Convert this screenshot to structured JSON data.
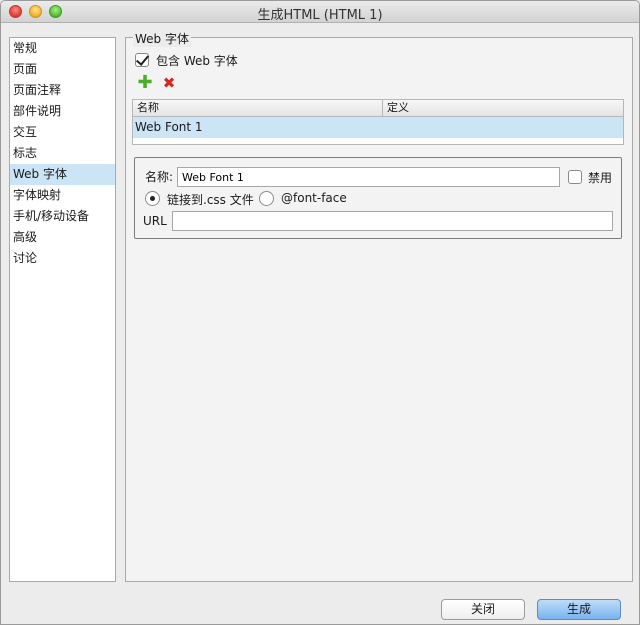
{
  "window": {
    "title": "生成HTML (HTML 1)"
  },
  "sidebar": {
    "items": [
      {
        "label": "常规"
      },
      {
        "label": "页面"
      },
      {
        "label": "页面注释"
      },
      {
        "label": "部件说明"
      },
      {
        "label": "交互"
      },
      {
        "label": "标志"
      },
      {
        "label": "Web 字体",
        "selected": true
      },
      {
        "label": "字体映射"
      },
      {
        "label": "手机/移动设备"
      },
      {
        "label": "高级"
      },
      {
        "label": "讨论"
      }
    ]
  },
  "webfont": {
    "group_title": "Web 字体",
    "include_label": "包含 Web 字体",
    "include_checked": true,
    "add_icon": "plus-icon",
    "remove_icon": "x-icon",
    "table": {
      "columns": [
        "名称",
        "定义"
      ],
      "rows": [
        {
          "name": "Web Font 1",
          "definition": ""
        }
      ]
    },
    "details": {
      "name_label": "名称:",
      "name_value": "Web Font 1",
      "disable_label": "禁用",
      "disable_checked": false,
      "radio_link_label": "链接到.css 文件",
      "radio_link_checked": true,
      "radio_fontface_label": "@font-face",
      "url_label": "URL",
      "url_value": ""
    }
  },
  "buttons": {
    "close": "关闭",
    "generate": "生成"
  }
}
